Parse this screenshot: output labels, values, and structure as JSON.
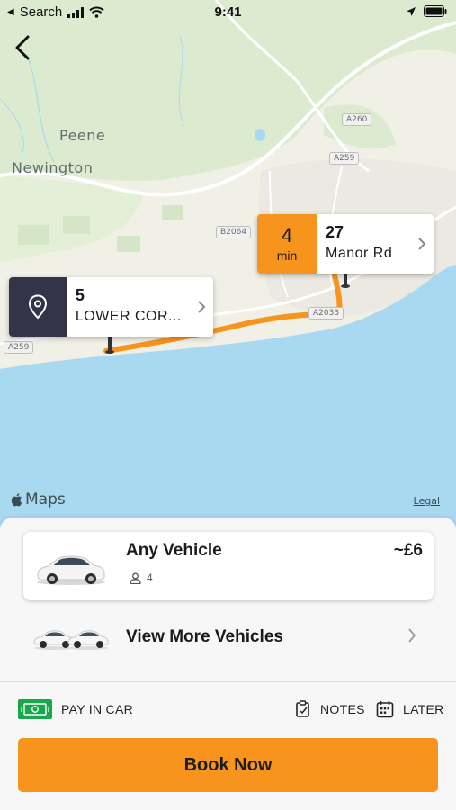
{
  "status_bar": {
    "back_app": "Search",
    "time": "9:41"
  },
  "map": {
    "place_labels": [
      "Peene",
      "Newington"
    ],
    "road_labels": [
      "A260",
      "A259",
      "B2064",
      "A2033",
      "A259"
    ],
    "attribution": "Maps",
    "legal": "Legal"
  },
  "pickup": {
    "line1": "5",
    "line2": "LOWER COR..."
  },
  "destination": {
    "eta_value": "4",
    "eta_unit": "min",
    "line1": "27",
    "line2": "Manor Rd"
  },
  "vehicle": {
    "name": "Any Vehicle",
    "price": "~£6",
    "seats": "4"
  },
  "more_vehicles": {
    "label": "View More Vehicles"
  },
  "options": {
    "payment": "PAY IN CAR",
    "notes": "NOTES",
    "later": "LATER"
  },
  "book_button": {
    "label": "Book Now"
  },
  "colors": {
    "accent": "#f7941d",
    "pickup_dark": "#33334a",
    "pay_green": "#1aa64a",
    "sea": "#a9d9f1",
    "land": "#f1f1e7"
  }
}
